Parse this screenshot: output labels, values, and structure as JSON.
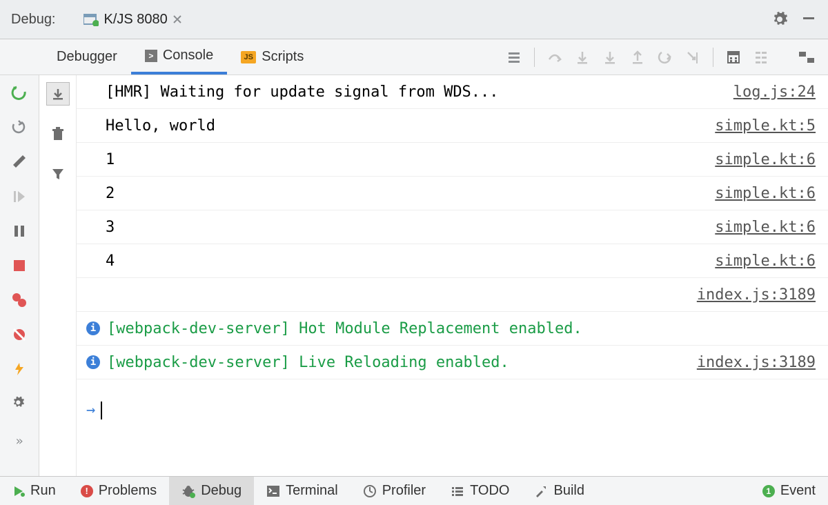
{
  "header": {
    "title": "Debug:",
    "tab_label": "K/JS 8080"
  },
  "tabs": {
    "debugger": "Debugger",
    "console": "Console",
    "scripts": "Scripts"
  },
  "console_rows": [
    {
      "msg": "[HMR] Waiting for update signal from WDS...",
      "src": "log.js:24",
      "type": "plain"
    },
    {
      "msg": "Hello, world",
      "src": "simple.kt:5",
      "type": "plain"
    },
    {
      "msg": "1",
      "src": "simple.kt:6",
      "type": "plain"
    },
    {
      "msg": "2",
      "src": "simple.kt:6",
      "type": "plain"
    },
    {
      "msg": "3",
      "src": "simple.kt:6",
      "type": "plain"
    },
    {
      "msg": "4",
      "src": "simple.kt:6",
      "type": "plain"
    },
    {
      "msg": "",
      "src": "index.js:3189",
      "type": "plain"
    },
    {
      "msg": "[webpack-dev-server] Hot Module Replacement enabled.",
      "src": "",
      "type": "info"
    },
    {
      "msg": "[webpack-dev-server] Live Reloading enabled.",
      "src": "index.js:3189",
      "type": "info"
    }
  ],
  "bottom": {
    "run": "Run",
    "problems": "Problems",
    "debug": "Debug",
    "terminal": "Terminal",
    "profiler": "Profiler",
    "todo": "TODO",
    "build": "Build",
    "event": "Event",
    "event_count": "1"
  }
}
